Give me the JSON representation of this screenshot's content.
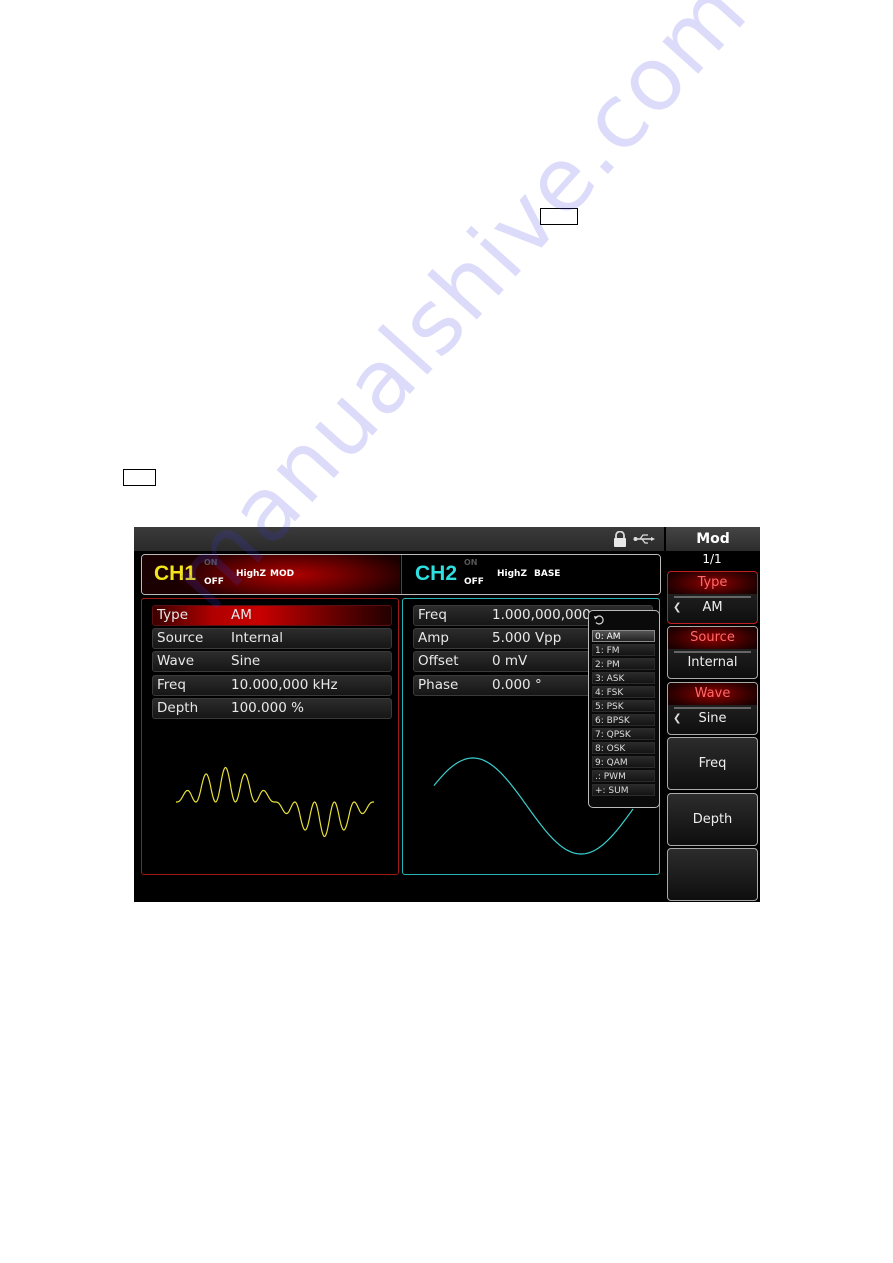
{
  "document": {
    "key_boxes": [
      "",
      ""
    ],
    "watermark": "manualshive.com"
  },
  "screen": {
    "status_icons": [
      "lock-icon",
      "usb-icon"
    ],
    "channels": {
      "ch1": {
        "name": "CH1",
        "on_label": "ON",
        "off_label": "OFF",
        "load": "HighZ",
        "mode": "MOD",
        "color": "#f2e41a"
      },
      "ch2": {
        "name": "CH2",
        "on_label": "ON",
        "off_label": "OFF",
        "load": "HighZ",
        "mode": "BASE",
        "color": "#2ee0e0"
      }
    },
    "ch1_params": [
      {
        "label": "Type",
        "value": "AM"
      },
      {
        "label": "Source",
        "value": "Internal"
      },
      {
        "label": "Wave",
        "value": "Sine"
      },
      {
        "label": "Freq",
        "value": "10.000,000 kHz"
      },
      {
        "label": "Depth",
        "value": "100.000 %"
      }
    ],
    "ch2_params": [
      {
        "label": "Freq",
        "value": "1.000,000,000"
      },
      {
        "label": "Amp",
        "value": "5.000 Vpp"
      },
      {
        "label": "Offset",
        "value": "0 mV"
      },
      {
        "label": "Phase",
        "value": "0.000 °"
      }
    ],
    "type_popup": {
      "selected": "0: AM",
      "options": [
        "0: AM",
        "1: FM",
        "2: PM",
        "3: ASK",
        "4: FSK",
        "5: PSK",
        "6: BPSK",
        "7: QPSK",
        "8: OSK",
        "9: QAM",
        ".: PWM",
        "+: SUM"
      ]
    },
    "softkeys": {
      "title": "Mod",
      "page": "1/1",
      "buttons": [
        {
          "header": "Type",
          "value": "AM",
          "selected": true
        },
        {
          "header": "Source",
          "value": "Internal"
        },
        {
          "header": "Wave",
          "value": "Sine"
        },
        {
          "label": "Freq"
        },
        {
          "label": "Depth"
        },
        {
          "label": ""
        }
      ]
    }
  }
}
